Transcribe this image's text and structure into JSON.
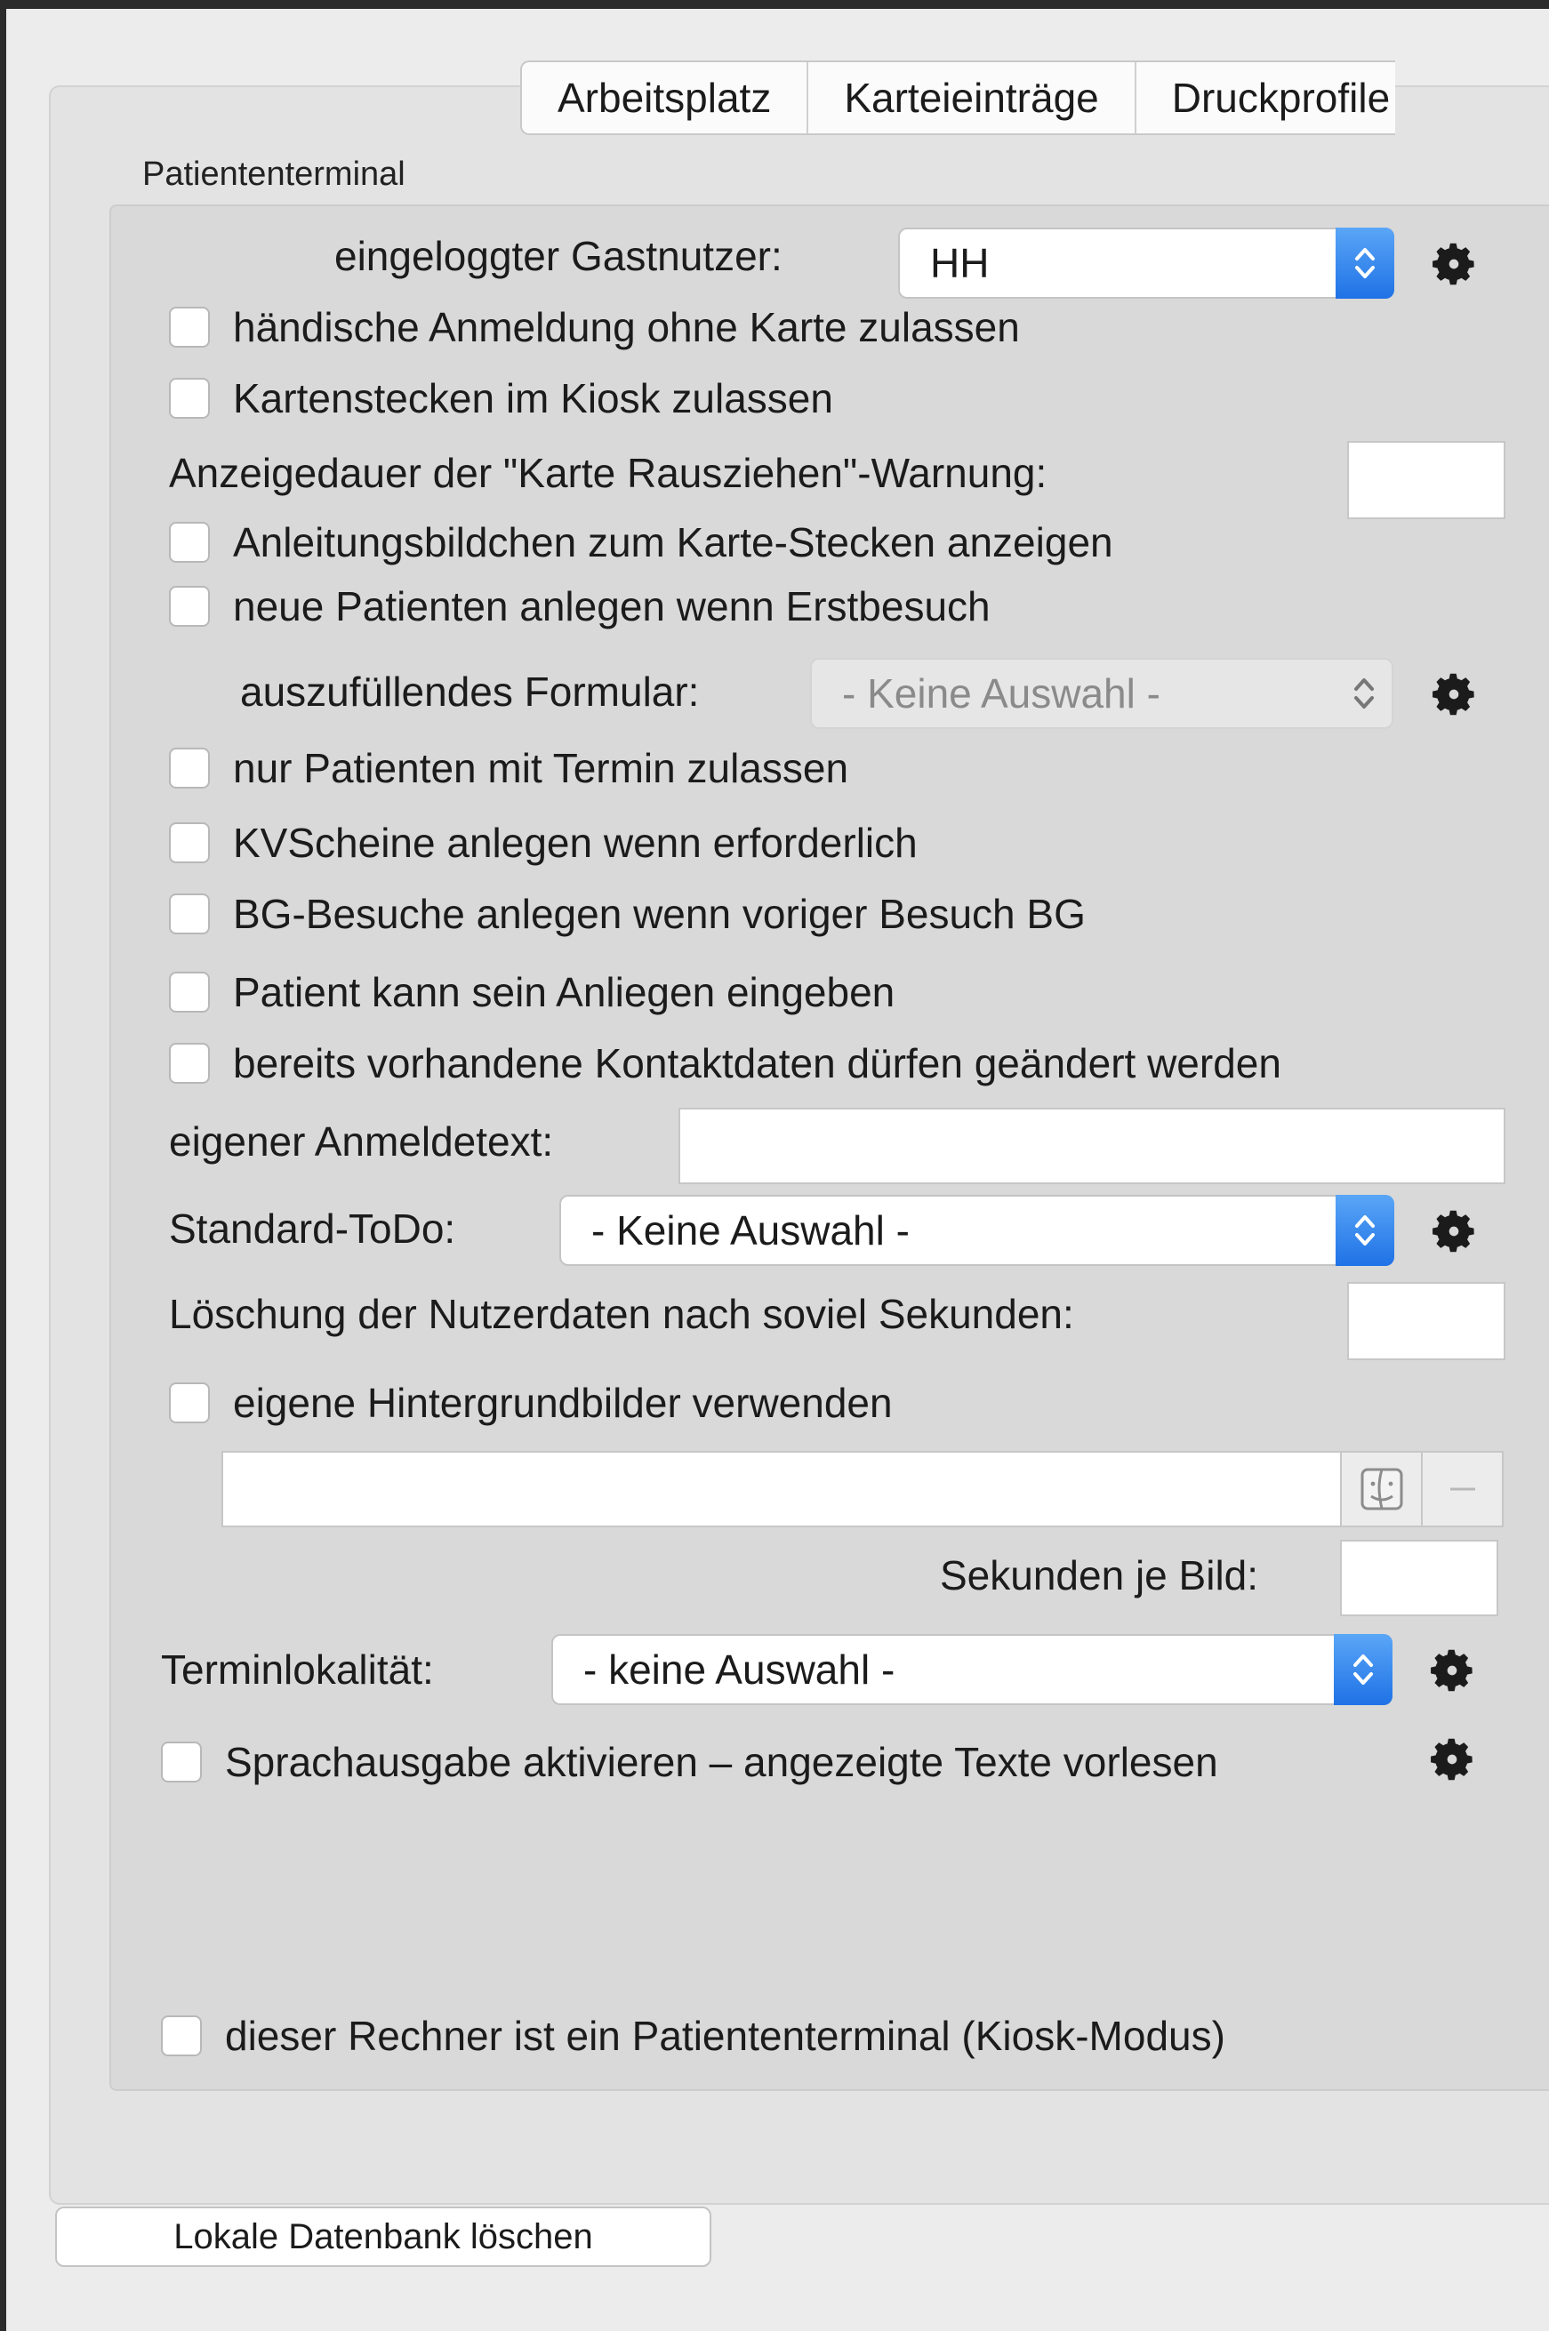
{
  "tabs": [
    "Arbeitsplatz",
    "Karteieinträge",
    "Druckprofile"
  ],
  "group_title": "Patiententerminal",
  "guest_user": {
    "label": "eingeloggter Gastnutzer:",
    "value": "HH"
  },
  "options": {
    "manual_login": "händische Anmeldung ohne Karte zulassen",
    "card_insert_kiosk": "Kartenstecken im Kiosk zulassen",
    "card_pictures": "Anleitungsbildchen zum Karte-Stecken anzeigen",
    "new_patients": "neue Patienten anlegen wenn Erstbesuch",
    "only_appointment": "nur Patienten mit Termin zulassen",
    "kv_scheine": "KVScheine anlegen wenn erforderlich",
    "bg_visits": "BG-Besuche anlegen wenn voriger Besuch BG",
    "concern": "Patient kann sein Anliegen eingeben",
    "contact_change": "bereits vorhandene Kontaktdaten dürfen geändert werden",
    "bg_images": "eigene Hintergrundbilder verwenden",
    "speech": "Sprachausgabe aktivieren – angezeigte Texte vorlesen",
    "kiosk_mode": "dieser Rechner ist ein Patiententerminal (Kiosk-Modus)"
  },
  "warning_duration": {
    "label": "Anzeigedauer der \"Karte Rausziehen\"-Warnung:",
    "value": ""
  },
  "form": {
    "label": "auszufüllendes Formular:",
    "value": "- Keine Auswahl -"
  },
  "login_text": {
    "label": "eigener Anmeldetext:",
    "value": ""
  },
  "standard_todo": {
    "label": "Standard-ToDo:",
    "value": "- Keine Auswahl -"
  },
  "deletion": {
    "label": "Löschung der Nutzerdaten nach soviel Sekunden:",
    "value": ""
  },
  "bg_path": {
    "value": ""
  },
  "seconds_per_image": {
    "label": "Sekunden je Bild:",
    "value": ""
  },
  "location": {
    "label": "Terminlokalität:",
    "value": "- keine Auswahl -"
  },
  "delete_db_button": "Lokale Datenbank löschen",
  "icons": {
    "gear": "gear-icon",
    "finder": "finder-icon",
    "minus": "minus-icon",
    "updown": "chevron-updown-icon"
  },
  "colors": {
    "accent": "#1f72e6",
    "panel": "#d9d9d9",
    "window": "#ececec"
  }
}
